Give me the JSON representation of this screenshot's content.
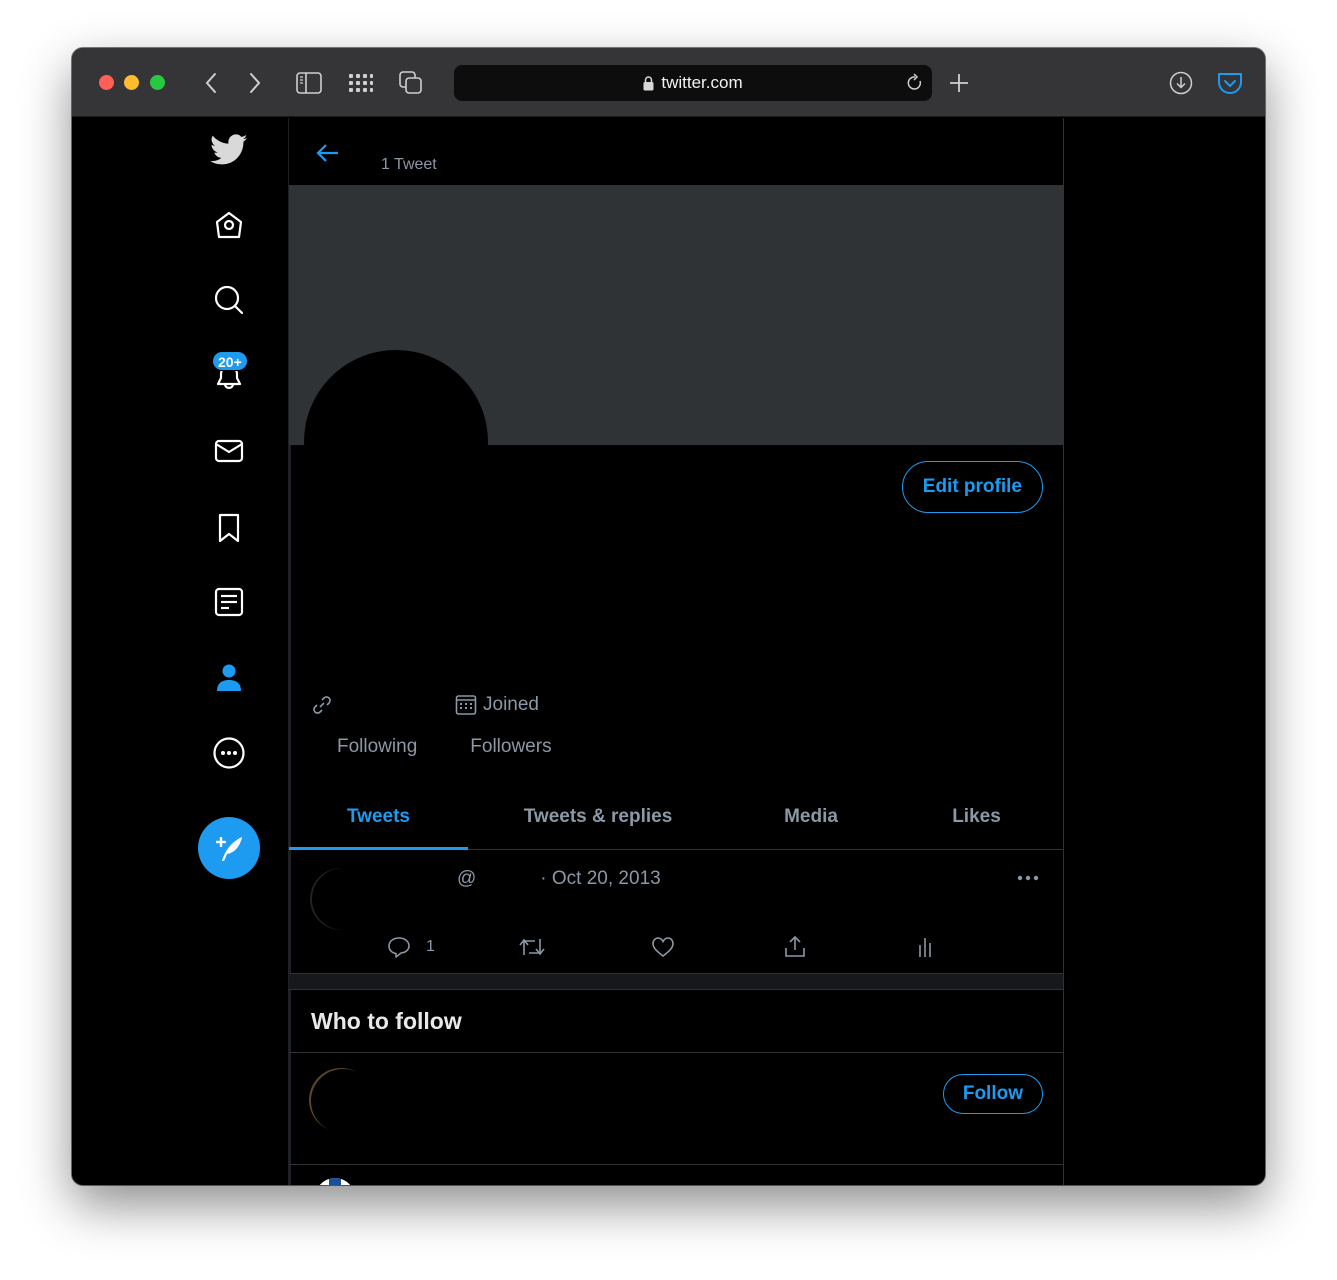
{
  "browser": {
    "url": "twitter.com",
    "buttons": {
      "back": "back",
      "forward": "forward",
      "sidebar": "sidebar",
      "tab_grid": "tab overview",
      "tabs": "tabs",
      "new_tab": "new tab",
      "downloads": "downloads",
      "pocket": "pocket"
    }
  },
  "sidebar": {
    "items": [
      {
        "name": "twitter-logo",
        "label": "Twitter"
      },
      {
        "name": "home",
        "label": "Home"
      },
      {
        "name": "explore",
        "label": "Explore"
      },
      {
        "name": "notifications",
        "label": "Notifications",
        "badge": "20+"
      },
      {
        "name": "messages",
        "label": "Messages"
      },
      {
        "name": "bookmarks",
        "label": "Bookmarks"
      },
      {
        "name": "lists",
        "label": "Lists"
      },
      {
        "name": "profile",
        "label": "Profile",
        "active": true
      },
      {
        "name": "more",
        "label": "More"
      }
    ],
    "notifications_badge": "20+",
    "compose_label": "Tweet"
  },
  "header": {
    "tweet_count": "1 Tweet"
  },
  "profile": {
    "edit_profile_label": "Edit profile",
    "joined_label": "Joined",
    "following_label": "Following",
    "followers_label": "Followers"
  },
  "tabs": [
    {
      "label": "Tweets",
      "active": true
    },
    {
      "label": "Tweets & replies",
      "active": false
    },
    {
      "label": "Media",
      "active": false
    },
    {
      "label": "Likes",
      "active": false
    }
  ],
  "tweet": {
    "handle_prefix": "@",
    "date": "· Oct 20, 2013",
    "reply_count": "1"
  },
  "who_to_follow": {
    "title": "Who to follow",
    "follow_label": "Follow"
  },
  "colors": {
    "accent": "#1d9bf0",
    "background": "#000000",
    "banner": "#2f3336",
    "secondary_text": "#8b98a5"
  }
}
